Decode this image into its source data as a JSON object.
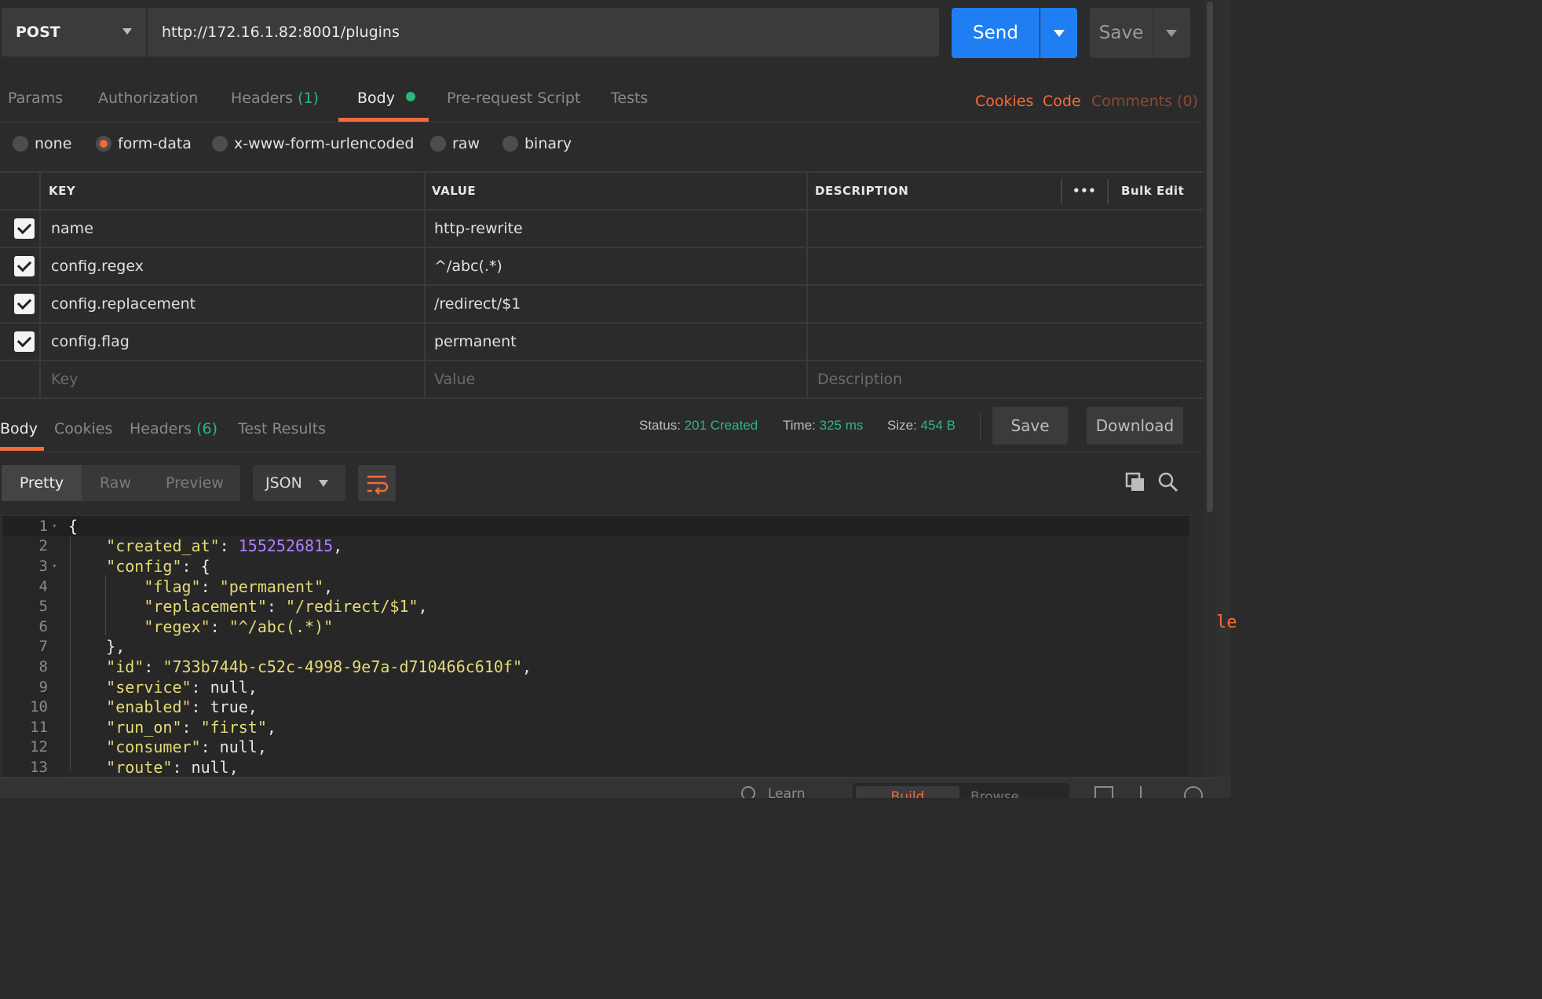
{
  "request": {
    "method": "POST",
    "url": "http://172.16.1.82:8001/plugins",
    "send_label": "Send",
    "save_label": "Save"
  },
  "request_tabs": [
    {
      "label": "Params"
    },
    {
      "label": "Authorization"
    },
    {
      "label": "Headers",
      "count": "(1)"
    },
    {
      "label": "Body",
      "active": true
    },
    {
      "label": "Pre-request Script"
    },
    {
      "label": "Tests"
    }
  ],
  "request_links": {
    "cookies": "Cookies",
    "code": "Code",
    "comments": "Comments (0)"
  },
  "body_types": [
    {
      "label": "none"
    },
    {
      "label": "form-data",
      "selected": true
    },
    {
      "label": "x-www-form-urlencoded"
    },
    {
      "label": "raw"
    },
    {
      "label": "binary"
    }
  ],
  "params_table": {
    "headers": {
      "key": "KEY",
      "value": "VALUE",
      "description": "DESCRIPTION",
      "bulk_edit": "Bulk Edit",
      "more": "•••"
    },
    "rows": [
      {
        "checked": true,
        "key": "name",
        "value": "http-rewrite",
        "description": ""
      },
      {
        "checked": true,
        "key": "config.regex",
        "value": "^/abc(.*)",
        "description": ""
      },
      {
        "checked": true,
        "key": "config.replacement",
        "value": "/redirect/$1",
        "description": ""
      },
      {
        "checked": true,
        "key": "config.flag",
        "value": "permanent",
        "description": ""
      }
    ],
    "placeholders": {
      "key": "Key",
      "value": "Value",
      "description": "Description"
    }
  },
  "response_tabs": [
    {
      "label": "Body",
      "active": true
    },
    {
      "label": "Cookies"
    },
    {
      "label": "Headers",
      "count": "(6)"
    },
    {
      "label": "Test Results"
    }
  ],
  "response_status": {
    "status_label": "Status:",
    "status_value": "201 Created",
    "time_label": "Time:",
    "time_value": "325 ms",
    "size_label": "Size:",
    "size_value": "454 B",
    "save_label": "Save",
    "download_label": "Download"
  },
  "view_modes": {
    "pretty": "Pretty",
    "raw": "Raw",
    "preview": "Preview",
    "format": "JSON"
  },
  "response_code": {
    "lines": [
      {
        "n": "1",
        "text": "{"
      },
      {
        "n": "2",
        "text": "    \"created_at\": 1552526815,"
      },
      {
        "n": "3",
        "text": "    \"config\": {"
      },
      {
        "n": "4",
        "text": "        \"flag\": \"permanent\","
      },
      {
        "n": "5",
        "text": "        \"replacement\": \"/redirect/$1\","
      },
      {
        "n": "6",
        "text": "        \"regex\": \"^/abc(.*)\""
      },
      {
        "n": "7",
        "text": "    },"
      },
      {
        "n": "8",
        "text": "    \"id\": \"733b744b-c52c-4998-9e7a-d710466c610f\","
      },
      {
        "n": "9",
        "text": "    \"service\": null,"
      },
      {
        "n": "10",
        "text": "    \"enabled\": true,"
      },
      {
        "n": "11",
        "text": "    \"run_on\": \"first\","
      },
      {
        "n": "12",
        "text": "    \"consumer\": null,"
      },
      {
        "n": "13",
        "text": "    \"route\": null,"
      }
    ]
  },
  "footer": {
    "learn": "Learn",
    "build": "Build",
    "browse": "Browse"
  },
  "edge_text": "le",
  "colors": {
    "accent": "#f26b3a",
    "primary": "#1f7ef2",
    "success": "#2fb67c",
    "json_key": "#e6db74",
    "json_number": "#ae81ff"
  }
}
